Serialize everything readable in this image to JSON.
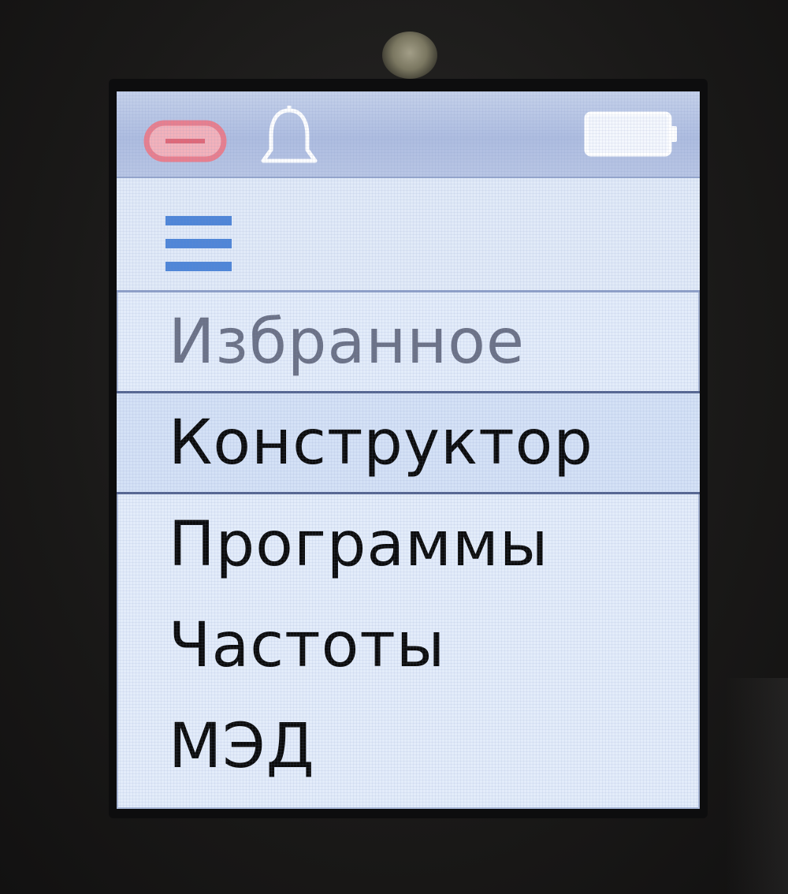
{
  "status_bar": {
    "icons": [
      "pill-icon",
      "bell-icon",
      "battery-icon"
    ],
    "pill_color": "#e87f8e",
    "battery_level": 1.0
  },
  "menu": {
    "header_icon": "hamburger-icon",
    "items": [
      {
        "label": "Избранное",
        "state": "dimmed"
      },
      {
        "label": "Конструктор",
        "state": "selected"
      },
      {
        "label": "Программы",
        "state": "normal"
      },
      {
        "label": "Частоты",
        "state": "normal"
      },
      {
        "label": "МЭД",
        "state": "normal"
      }
    ]
  },
  "colors": {
    "screen_background": "#e3ecfa",
    "statusbar_background": "#b9c6e4",
    "accent_blue": "#3f7bd6",
    "text": "#0c0c0c",
    "dimmed_text": "#6c7286"
  }
}
